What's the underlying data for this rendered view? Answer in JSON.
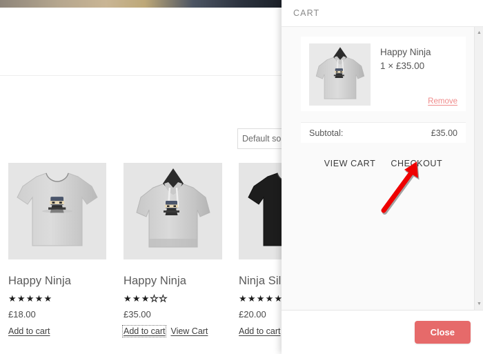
{
  "store": {
    "sorting": {
      "value": "Default sorting",
      "label": "Default sorting"
    },
    "products": [
      {
        "title": "Happy Ninja",
        "rating_filled": 5,
        "rating_total": 5,
        "price": "£18.00",
        "add_label": "Add to cart",
        "view_cart_label": "",
        "image_name": "grey-tshirt-ninja"
      },
      {
        "title": "Happy Ninja",
        "rating_filled": 3,
        "rating_total": 5,
        "price": "£35.00",
        "add_label": "Add to cart",
        "view_cart_label": "View Cart",
        "image_name": "grey-hoodie-ninja"
      },
      {
        "title": "Ninja Silhouette",
        "rating_filled": 5,
        "rating_total": 5,
        "price": "£20.00",
        "add_label": "Add to cart",
        "view_cart_label": "",
        "image_name": "black-tshirt-silhouette"
      }
    ]
  },
  "cart": {
    "header_title": "CART",
    "items": [
      {
        "name": "Happy Ninja",
        "quantity_price": "1 × £35.00",
        "remove_label": "Remove",
        "image_name": "grey-hoodie-ninja"
      }
    ],
    "subtotal_label": "Subtotal:",
    "subtotal_value": "£35.00",
    "view_cart_label": "VIEW CART",
    "checkout_label": "CHECKOUT",
    "close_label": "Close",
    "scroll_up_icon": "▲",
    "scroll_down_icon": "▼"
  },
  "annotation": {
    "arrow_color": "#ee0000",
    "points_to": "CHECKOUT"
  },
  "colors": {
    "close_button": "#e66a6a",
    "remove_link": "#ef8a8a",
    "panel_bg": "#fafafa",
    "arrow": "#ee0000"
  },
  "star_filled": "★",
  "star_empty": "★"
}
